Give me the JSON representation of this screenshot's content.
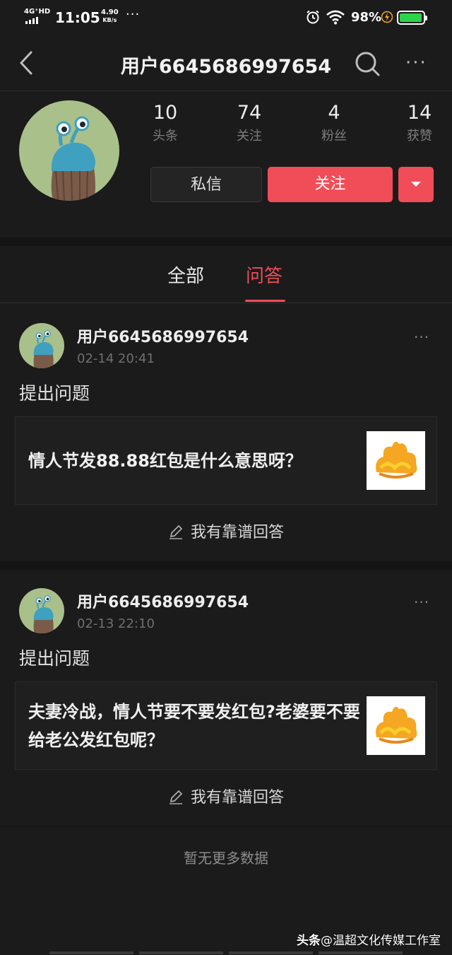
{
  "status_bar": {
    "network": "4G⁺HD",
    "time": "11:05",
    "speed_value": "4.90",
    "speed_unit": "KB/s",
    "more": "···",
    "battery_percent": "98%",
    "battery_level": 0.98,
    "battery_color": "#2bd44a"
  },
  "header": {
    "back_icon": "chevron-left-icon",
    "title": "用户6645686997654",
    "search_icon": "search-icon",
    "more": "···"
  },
  "profile": {
    "stats": [
      {
        "value": "10",
        "label": "头条"
      },
      {
        "value": "74",
        "label": "关注"
      },
      {
        "value": "4",
        "label": "粉丝"
      },
      {
        "value": "14",
        "label": "获赞"
      }
    ],
    "message_button": "私信",
    "follow_button": "关注",
    "accent_color": "#f04d58"
  },
  "tabs": [
    {
      "label": "全部",
      "active": false
    },
    {
      "label": "问答",
      "active": true
    }
  ],
  "feed": [
    {
      "username": "用户6645686997654",
      "date": "02-14 20:41",
      "action": "提出问题",
      "question": "情人节发88.88红包是什么意思呀？",
      "answer_label": "我有靠谱回答",
      "more": "···"
    },
    {
      "username": "用户6645686997654",
      "date": "02-13 22:10",
      "action": "提出问题",
      "question": "夫妻冷战，情人节要不要发红包?老婆要不要给老公发红包呢？",
      "answer_label": "我有靠谱回答",
      "more": "···"
    }
  ],
  "footer": {
    "no_more": "暂无更多数据"
  },
  "watermark": {
    "brand": "头条",
    "handle": "@温超文化传媒工作室"
  }
}
